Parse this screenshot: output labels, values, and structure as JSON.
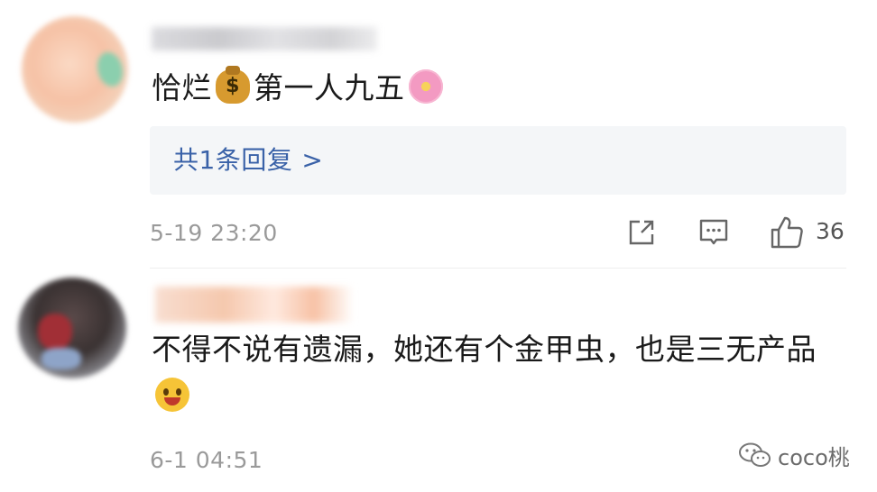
{
  "comments": [
    {
      "text_before": "恰烂",
      "emoji_1": "money-bag",
      "text_middle": "第一人九五",
      "emoji_2": "cherry-blossom",
      "reply_summary": "共1条回复",
      "reply_chevron": ">",
      "timestamp": "5-19 23:20",
      "like_count": "36"
    },
    {
      "text": "不得不说有遗漏，她还有个金甲虫，也是三无产品",
      "emoji": "smiling-face-with-open-hands",
      "timestamp": "6-1 04:51"
    }
  ],
  "icons": [
    "share-icon",
    "comment-icon",
    "like-icon",
    "wechat-icon"
  ],
  "watermark": {
    "text": "coco桃"
  },
  "colors": {
    "reply_link": "#3a62a8",
    "reply_box": "#f4f6f8",
    "timestamp": "#9a9a9a",
    "text": "#1a1a1a"
  }
}
